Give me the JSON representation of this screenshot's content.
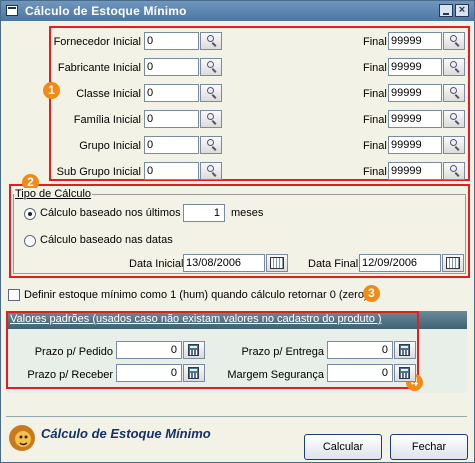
{
  "window": {
    "title": "Cálculo de Estoque Mínimo",
    "title_bar_color": "#5a82ad"
  },
  "filters": {
    "rows": [
      {
        "label": "Fornecedor Inicial",
        "initial": "0",
        "final_label": "Final",
        "final": "99999"
      },
      {
        "label": "Fabricante Inicial",
        "initial": "0",
        "final_label": "Final",
        "final": "99999"
      },
      {
        "label": "Classe Inicial",
        "initial": "0",
        "final_label": "Final",
        "final": "99999"
      },
      {
        "label": "Família Inicial",
        "initial": "0",
        "final_label": "Final",
        "final": "99999"
      },
      {
        "label": "Grupo Inicial",
        "initial": "0",
        "final_label": "Final",
        "final": "99999"
      },
      {
        "label": "Sub Grupo Inicial",
        "initial": "0",
        "final_label": "Final",
        "final": "99999"
      }
    ]
  },
  "calc_type": {
    "legend": "Tipo de Cálculo",
    "option_months_label": "Cálculo baseado nos últimos",
    "months_value": "1",
    "months_suffix": "meses",
    "option_dates_label": "Cálculo baseado nas datas",
    "selected": "months",
    "date_initial_label": "Data Inicial",
    "date_initial": "13/08/2006",
    "date_final_label": "Data Final",
    "date_final": "12/09/2006"
  },
  "min_stock_checkbox": {
    "label": "Definir estoque mínimo como 1 (hum) quando cálculo retornar 0 (zero)",
    "checked": false
  },
  "defaults": {
    "header": "Valores padrões (usados caso não existam valores no cadastro do produto )",
    "prazo_pedido_label": "Prazo p/ Pedido",
    "prazo_pedido": "0",
    "prazo_entrega_label": "Prazo p/ Entrega",
    "prazo_entrega": "0",
    "prazo_receber_label": "Prazo p/ Receber",
    "prazo_receber": "0",
    "margem_label": "Margem Segurança",
    "margem": "0"
  },
  "annotations": {
    "badge1": "1",
    "badge2": "2",
    "badge3": "3",
    "badge4": "4",
    "highlight_color": "#e02020",
    "badge_color": "#f28a16"
  },
  "footer": {
    "brand_title": "Cálculo de Estoque Mínimo",
    "calcular_label": "Calcular",
    "fechar_label": "Fechar",
    "icons": [
      "lion-logo-icon",
      "minimize-icon",
      "close-icon",
      "search-icon",
      "calendar-icon",
      "calculator-icon"
    ]
  }
}
